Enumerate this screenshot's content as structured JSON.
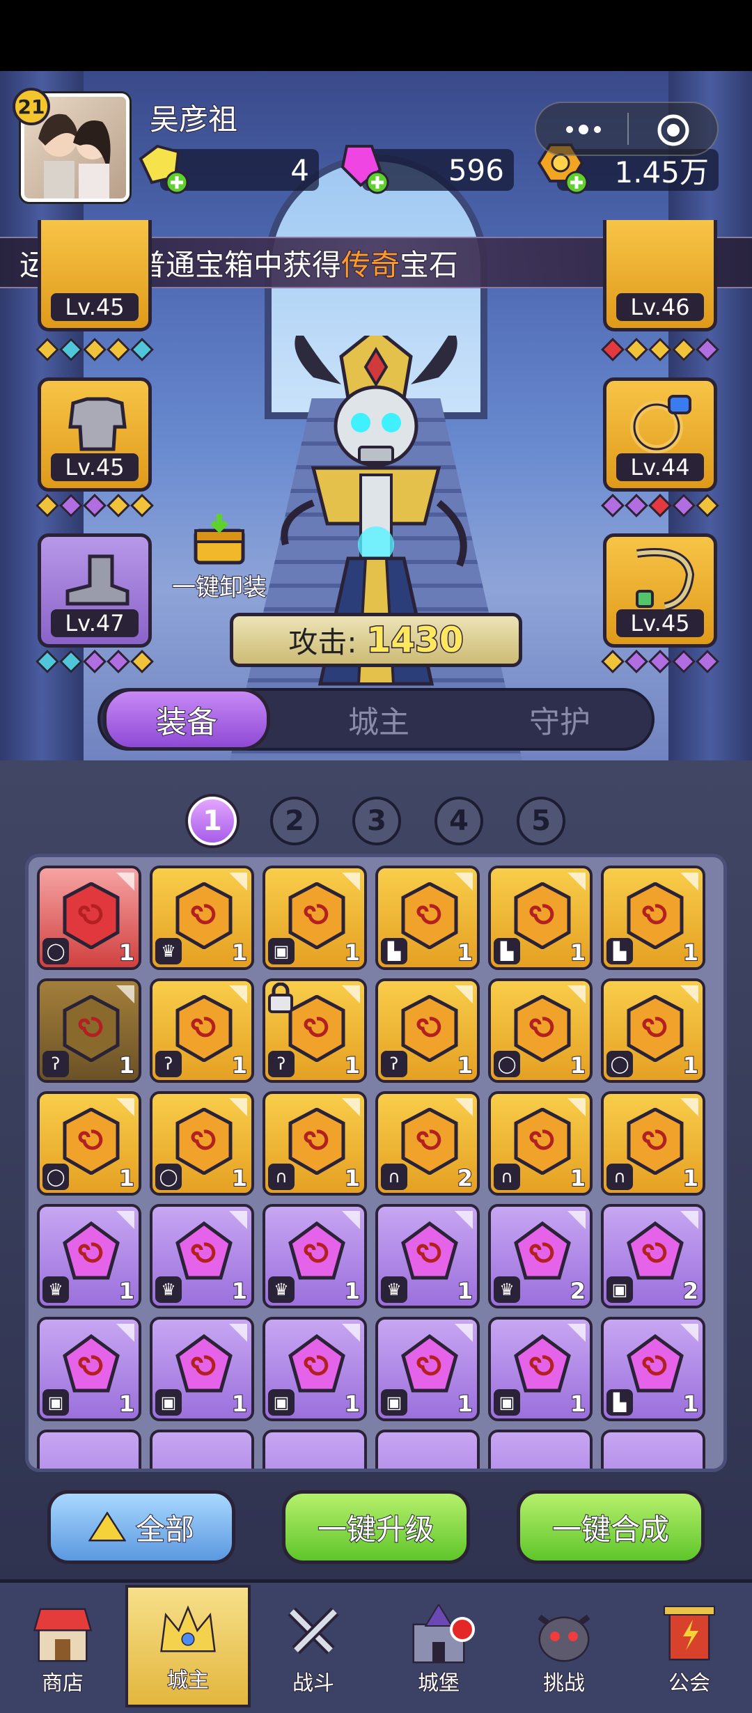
{
  "player": {
    "level": "21",
    "name": "吴彦祖"
  },
  "currencies": [
    {
      "icon": "gold-crystal-icon",
      "value": "4"
    },
    {
      "icon": "pink-gem-icon",
      "value": "596"
    },
    {
      "icon": "coin-icon",
      "value": "1.45万"
    }
  ],
  "ticker": {
    "prefix": "运惊人，普通宝箱中获得",
    "highlight": "传奇",
    "suffix": "宝石"
  },
  "slots": {
    "crown": {
      "level": "Lv.45"
    },
    "armor": {
      "level": "Lv.45"
    },
    "boots": {
      "level": "Lv.47"
    },
    "hook": {
      "level": "Lv.46"
    },
    "ring": {
      "level": "Lv.44"
    },
    "amulet": {
      "level": "Lv.45"
    }
  },
  "unequip_label": "一键卸装",
  "attack": {
    "label": "攻击:",
    "value": "1430"
  },
  "tabs": [
    "装备",
    "城主",
    "守护"
  ],
  "pages": [
    "1",
    "2",
    "3",
    "4",
    "5"
  ],
  "gems": [
    {
      "color": "red",
      "slot": "ring",
      "count": "1"
    },
    {
      "color": "orange",
      "slot": "crown",
      "count": "1"
    },
    {
      "color": "orange",
      "slot": "armor",
      "count": "1"
    },
    {
      "color": "orange",
      "slot": "boots",
      "count": "1"
    },
    {
      "color": "orange",
      "slot": "boots",
      "count": "1"
    },
    {
      "color": "orange",
      "slot": "boots",
      "count": "1"
    },
    {
      "color": "dim",
      "slot": "hook",
      "count": "1"
    },
    {
      "color": "orange",
      "slot": "hook",
      "count": "1"
    },
    {
      "color": "orange",
      "slot": "hook",
      "count": "1",
      "locked": true
    },
    {
      "color": "orange",
      "slot": "hook",
      "count": "1"
    },
    {
      "color": "orange",
      "slot": "ring",
      "count": "1"
    },
    {
      "color": "orange",
      "slot": "ring",
      "count": "1"
    },
    {
      "color": "orange",
      "slot": "ring",
      "count": "1"
    },
    {
      "color": "orange",
      "slot": "ring",
      "count": "1"
    },
    {
      "color": "orange",
      "slot": "amulet",
      "count": "1"
    },
    {
      "color": "orange",
      "slot": "amulet",
      "count": "2"
    },
    {
      "color": "orange",
      "slot": "amulet",
      "count": "1"
    },
    {
      "color": "orange",
      "slot": "amulet",
      "count": "1"
    },
    {
      "color": "violet",
      "slot": "crown",
      "count": "1"
    },
    {
      "color": "violet",
      "slot": "crown",
      "count": "1"
    },
    {
      "color": "violet",
      "slot": "crown",
      "count": "1"
    },
    {
      "color": "violet",
      "slot": "crown",
      "count": "1"
    },
    {
      "color": "violet",
      "slot": "crown",
      "count": "2"
    },
    {
      "color": "violet",
      "slot": "armor",
      "count": "2"
    },
    {
      "color": "violet",
      "slot": "armor",
      "count": "1"
    },
    {
      "color": "violet",
      "slot": "armor",
      "count": "1"
    },
    {
      "color": "violet",
      "slot": "armor",
      "count": "1"
    },
    {
      "color": "violet",
      "slot": "armor",
      "count": "1"
    },
    {
      "color": "violet",
      "slot": "armor",
      "count": "1"
    },
    {
      "color": "violet",
      "slot": "boots",
      "count": "1"
    }
  ],
  "actions": {
    "all": "全部",
    "upgrade": "一键升级",
    "merge": "一键合成"
  },
  "nav": [
    {
      "label": "商店",
      "icon": "shop-icon"
    },
    {
      "label": "城主",
      "icon": "crown-icon",
      "active": true
    },
    {
      "label": "战斗",
      "icon": "swords-icon"
    },
    {
      "label": "城堡",
      "icon": "castle-icon",
      "badge": true
    },
    {
      "label": "挑战",
      "icon": "demon-icon"
    },
    {
      "label": "公会",
      "icon": "guild-banner-icon"
    }
  ],
  "colors": {
    "orange_gem": "#f0a22a",
    "violet_gem": "#e463e8",
    "red_gem": "#e23a3f",
    "tab_active": "#a65de8",
    "button_green": "#6ccb2f",
    "button_blue": "#6aa6e8"
  }
}
